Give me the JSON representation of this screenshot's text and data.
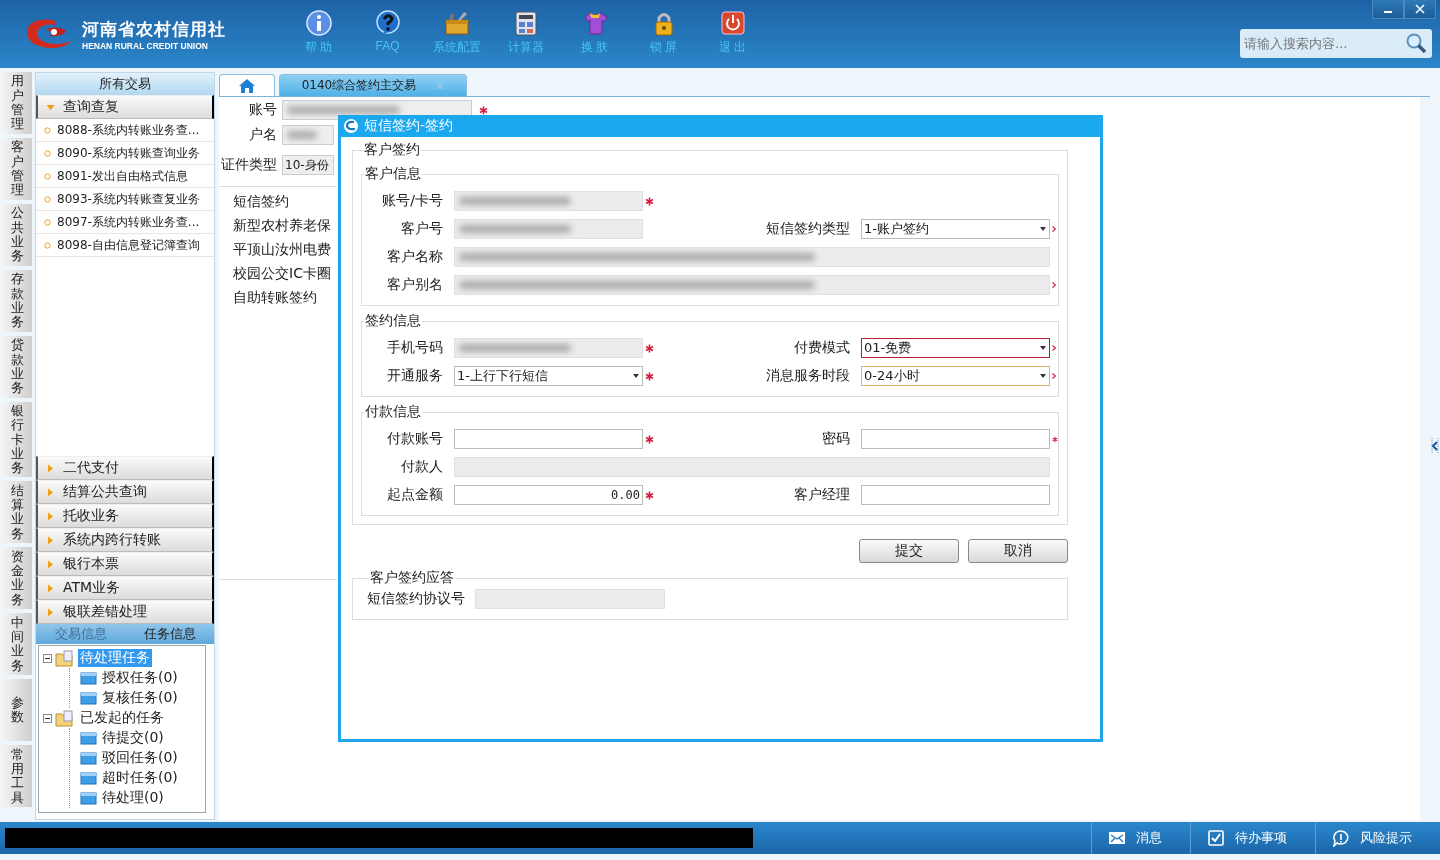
{
  "app": {
    "logo_title": "河南省农村信用社",
    "logo_subtitle": "HENAN RURAL CREDIT UNION"
  },
  "toolbar": [
    "帮 助",
    "FAQ",
    "系统配置",
    "计算器",
    "换 肤",
    "锁 屏",
    "退 出"
  ],
  "search": {
    "placeholder": "请输入搜索内容..."
  },
  "side_tabs": [
    "用户管理",
    "客户管理",
    "公共业务",
    "存款业务",
    "贷款业务",
    "银行卡业务",
    "结算业务",
    "资金业务",
    "中间业务",
    "参数",
    "常用工具"
  ],
  "nav": {
    "title": "所有交易",
    "groups": [
      {
        "label": "查询查复",
        "expanded": true,
        "items": [
          "8088-系统内转账业务查...",
          "8090-系统内转账查询业务",
          "8091-发出自由格式信息",
          "8093-系统内转账查复业务",
          "8097-系统内转账业务查...",
          "8098-自由信息登记簿查询"
        ]
      },
      {
        "label": "二代支付",
        "expanded": false
      },
      {
        "label": "结算公共查询",
        "expanded": false
      },
      {
        "label": "托收业务",
        "expanded": false
      },
      {
        "label": "系统内跨行转账",
        "expanded": false
      },
      {
        "label": "银行本票",
        "expanded": false
      },
      {
        "label": "ATM业务",
        "expanded": false
      },
      {
        "label": "银联差错处理",
        "expanded": false
      }
    ]
  },
  "info_tabs": [
    {
      "label": "交易信息",
      "selected": false
    },
    {
      "label": "任务信息",
      "selected": true
    }
  ],
  "task_tree": [
    {
      "label": "待处理任务",
      "selected": true,
      "expanded": true,
      "children": [
        {
          "label": "授权任务(0)",
          "selected": false
        },
        {
          "label": "复核任务(0)",
          "selected": false
        }
      ]
    },
    {
      "label": "已发起的任务",
      "selected": false,
      "expanded": true,
      "children": [
        {
          "label": "待提交(0)",
          "selected": false
        },
        {
          "label": "驳回任务(0)",
          "selected": false
        },
        {
          "label": "超时任务(0)",
          "selected": false
        },
        {
          "label": "待处理(0)",
          "selected": false
        }
      ]
    }
  ],
  "main_tabs": [
    {
      "kind": "home",
      "selected": false
    },
    {
      "kind": "page",
      "label": "0140综合签约主交易",
      "selected": true
    }
  ],
  "back_form": {
    "rows": [
      {
        "label": "账号",
        "kind": "text",
        "redacted": true,
        "required": true
      },
      {
        "label": "户名",
        "kind": "text",
        "redacted": true
      },
      {
        "label": "证件类型",
        "kind": "select",
        "value": "10-身份"
      }
    ],
    "list": [
      "短信签约",
      "新型农村养老保",
      "平顶山汝州电费",
      "校园公交IC卡圈",
      "自助转账签约"
    ]
  },
  "dialog": {
    "title": "短信签约-签约",
    "section": "客户签约",
    "groups": [
      {
        "title": "客户信息",
        "rows": [
          [
            {
              "label": "账号/卡号",
              "kind": "text",
              "disabled": true,
              "redacted": true,
              "required": true
            }
          ],
          [
            {
              "label": "客户号",
              "kind": "text",
              "disabled": true,
              "redacted": true
            },
            {
              "label": "短信签约类型",
              "kind": "select",
              "value": "1-账户签约",
              "flagged": true
            }
          ],
          [
            {
              "label": "客户名称",
              "kind": "text",
              "disabled": true,
              "redacted": true,
              "full": true
            }
          ],
          [
            {
              "label": "客户别名",
              "kind": "text",
              "disabled": true,
              "redacted": true,
              "full": true,
              "flagged": true
            }
          ]
        ]
      },
      {
        "title": "签约信息",
        "rows": [
          [
            {
              "label": "手机号码",
              "kind": "text",
              "disabled": true,
              "redacted": true,
              "required": true
            },
            {
              "label": "付费模式",
              "kind": "select",
              "value": "01-免费",
              "flagged": true,
              "invalid": true
            }
          ],
          [
            {
              "label": "开通服务",
              "kind": "select",
              "value": "1-上行下行短信",
              "required": true
            },
            {
              "label": "消息服务时段",
              "kind": "select",
              "value": "0-24小时",
              "flagged": true,
              "hovered": true
            }
          ]
        ]
      },
      {
        "title": "付款信息",
        "rows": [
          [
            {
              "label": "付款账号",
              "kind": "text",
              "required": true
            },
            {
              "label": "密码",
              "kind": "text",
              "required": true
            }
          ],
          [
            {
              "label": "付款人",
              "kind": "text",
              "disabled": true,
              "full": true
            }
          ],
          [
            {
              "label": "起点金额",
              "kind": "text",
              "value": "0.00",
              "required": true
            },
            {
              "label": "客户经理",
              "kind": "text"
            }
          ]
        ]
      }
    ],
    "buttons": [
      "提交",
      "取消"
    ],
    "response": {
      "title": "客户签约应答",
      "label": "短信签约协议号"
    }
  },
  "status_bar": [
    "消息",
    "待办事项",
    "风险提示"
  ]
}
